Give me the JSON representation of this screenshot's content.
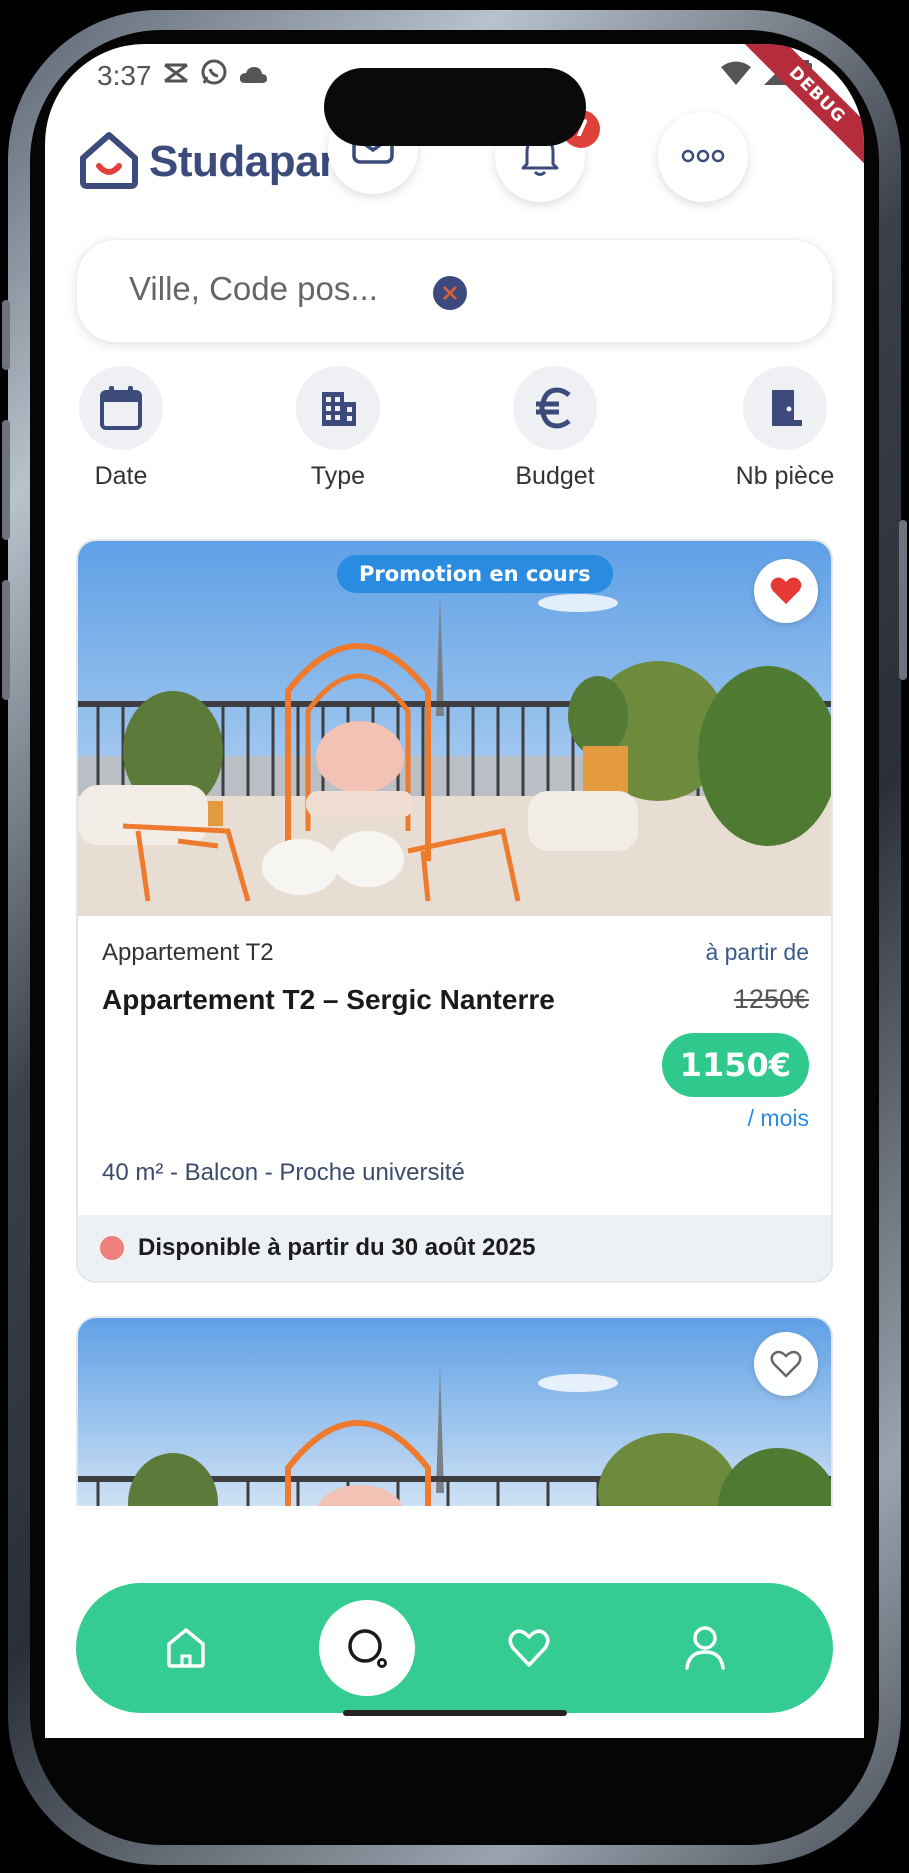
{
  "status_bar": {
    "time": "3:37",
    "debug_label": "DEBUG"
  },
  "header": {
    "logo_text": "Studapart",
    "notifications_count": "7"
  },
  "search": {
    "placeholder": "Ville, Code pos..."
  },
  "filters": [
    {
      "label": "Date",
      "icon": "calendar-icon"
    },
    {
      "label": "Type",
      "icon": "building-icon"
    },
    {
      "label": "Budget",
      "icon": "euro-icon"
    },
    {
      "label": "Nb pièce",
      "icon": "door-icon"
    }
  ],
  "listings": [
    {
      "promo_label": "Promotion en cours",
      "favorited": true,
      "type": "Appartement T2",
      "title": "Appartement T2 – Sergic Nanterre",
      "price_from_label": "à partir de",
      "old_price": "1250€",
      "price": "1150€",
      "period": "/ mois",
      "features": "40 m² - Balcon - Proche université",
      "availability": "Disponible à partir du 30 août 2025"
    },
    {
      "favorited": false
    }
  ],
  "bottom_nav": {
    "items": [
      "home-icon",
      "search-icon",
      "heart-icon",
      "profile-icon"
    ],
    "active": "search-icon"
  },
  "colors": {
    "brand": "#3c4a7c",
    "accent_green": "#34cc93",
    "price_green": "#2fc98e",
    "promo_blue": "#2a8ce0",
    "badge_red": "#e0403a",
    "favorite_red": "#e53935"
  }
}
